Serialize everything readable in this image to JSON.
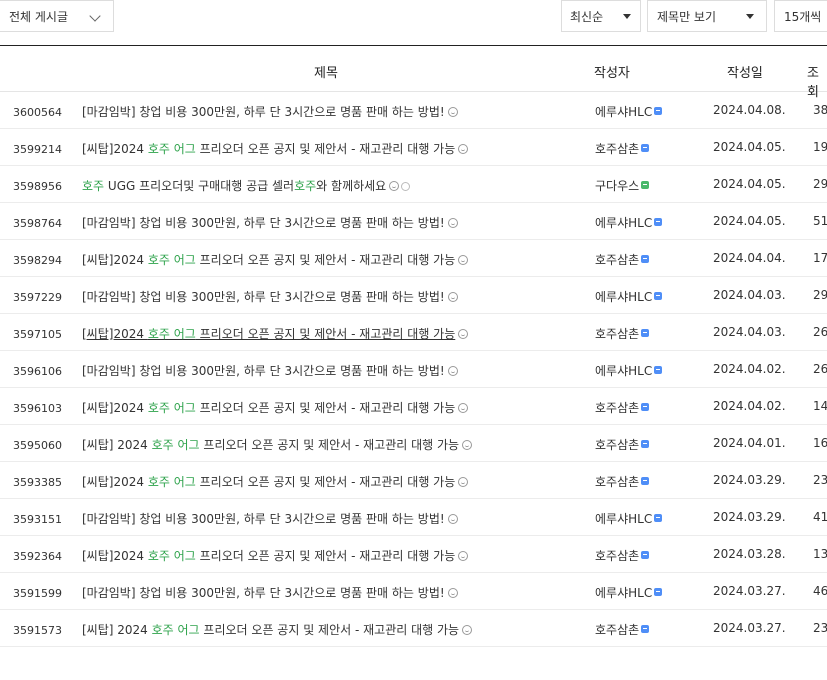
{
  "filters": {
    "all_posts": "전체 게시글",
    "sort": "최신순",
    "view_mode": "제목만 보기",
    "page_size": "15개씩"
  },
  "table": {
    "headers": {
      "title": "제목",
      "author": "작성자",
      "date": "작성일",
      "views": "조회"
    },
    "rows": [
      {
        "no": "3600564",
        "prefix": "[마감임박] 창업 비용 300만원, 하루 단 3시간으로 명품 판매 하는 방법!",
        "hl": "",
        "mid": "",
        "hl2": "",
        "suffix": "",
        "author": "에루샤HLC",
        "date": "2024.04.08.",
        "views": "38"
      },
      {
        "no": "3599214",
        "prefix": "[씨탑]2024 ",
        "hl": "호주 어그",
        "mid": " 프리오더 오픈 공지 및 제안서 - 재고관리 대행 가능",
        "hl2": "",
        "suffix": "",
        "author": "호주삼촌",
        "date": "2024.04.05.",
        "views": "19"
      },
      {
        "no": "3598956",
        "prefix": "",
        "hl": "호주",
        "mid": " UGG 프리오더및 구매대행 공급 셀러",
        "hl2": "호주",
        "suffix": "와 함께하세요",
        "author": "구다우스",
        "date": "2024.04.05.",
        "views": "29"
      },
      {
        "no": "3598764",
        "prefix": "[마감임박] 창업 비용 300만원, 하루 단 3시간으로 명품 판매 하는 방법!",
        "hl": "",
        "mid": "",
        "hl2": "",
        "suffix": "",
        "author": "에루샤HLC",
        "date": "2024.04.05.",
        "views": "51"
      },
      {
        "no": "3598294",
        "prefix": "[씨탑]2024 ",
        "hl": "호주 어그",
        "mid": " 프리오더 오픈 공지 및 제안서 - 재고관리 대행 가능",
        "hl2": "",
        "suffix": "",
        "author": "호주삼촌",
        "date": "2024.04.04.",
        "views": "17"
      },
      {
        "no": "3597229",
        "prefix": "[마감임박] 창업 비용 300만원, 하루 단 3시간으로 명품 판매 하는 방법!",
        "hl": "",
        "mid": "",
        "hl2": "",
        "suffix": "",
        "author": "에루샤HLC",
        "date": "2024.04.03.",
        "views": "29"
      },
      {
        "no": "3597105",
        "prefix": "[씨탑]2024 ",
        "hl": "호주 어그",
        "mid": " 프리오더 오픈 공지 및 제안서 - 재고관리 대행 가능",
        "hl2": "",
        "suffix": "",
        "author": "호주삼촌",
        "date": "2024.04.03.",
        "views": "26"
      },
      {
        "no": "3596106",
        "prefix": "[마감임박] 창업 비용 300만원, 하루 단 3시간으로 명품 판매 하는 방법!",
        "hl": "",
        "mid": "",
        "hl2": "",
        "suffix": "",
        "author": "에루샤HLC",
        "date": "2024.04.02.",
        "views": "26"
      },
      {
        "no": "3596103",
        "prefix": "[씨탑]2024 ",
        "hl": "호주 어그",
        "mid": " 프리오더 오픈 공지 및 제안서 - 재고관리 대행 가능",
        "hl2": "",
        "suffix": "",
        "author": "호주삼촌",
        "date": "2024.04.02.",
        "views": "14"
      },
      {
        "no": "3595060",
        "prefix": "[씨탑] 2024 ",
        "hl": "호주 어그",
        "mid": " 프리오더 오픈 공지 및 제안서 - 재고관리 대행 가능",
        "hl2": "",
        "suffix": "",
        "author": "호주삼촌",
        "date": "2024.04.01.",
        "views": "16"
      },
      {
        "no": "3593385",
        "prefix": "[씨탑]2024 ",
        "hl": "호주 어그",
        "mid": " 프리오더 오픈 공지 및 제안서 - 재고관리 대행 가능",
        "hl2": "",
        "suffix": "",
        "author": "호주삼촌",
        "date": "2024.03.29.",
        "views": "23"
      },
      {
        "no": "3593151",
        "prefix": "[마감임박] 창업 비용 300만원, 하루 단 3시간으로 명품 판매 하는 방법!",
        "hl": "",
        "mid": "",
        "hl2": "",
        "suffix": "",
        "author": "에루샤HLC",
        "date": "2024.03.29.",
        "views": "41"
      },
      {
        "no": "3592364",
        "prefix": "[씨탑]2024 ",
        "hl": "호주 어그",
        "mid": " 프리오더 오픈 공지 및 제안서 - 재고관리 대행 가능",
        "hl2": "",
        "suffix": "",
        "author": "호주삼촌",
        "date": "2024.03.28.",
        "views": "13"
      },
      {
        "no": "3591599",
        "prefix": "[마감임박] 창업 비용 300만원, 하루 단 3시간으로 명품 판매 하는 방법!",
        "hl": "",
        "mid": "",
        "hl2": "",
        "suffix": "",
        "author": "에루샤HLC",
        "date": "2024.03.27.",
        "views": "46"
      },
      {
        "no": "3591573",
        "prefix": "[씨탑] 2024 ",
        "hl": "호주 어그",
        "mid": " 프리오더 오픈 공지 및 제안서 - 재고관리 대행 가능",
        "hl2": "",
        "suffix": "",
        "author": "호주삼촌",
        "date": "2024.03.27.",
        "views": "23"
      }
    ]
  },
  "colors": {
    "highlight": "#2fa34c",
    "member_badge": "#4f8ef7",
    "new_member_badge": "#48b86a"
  }
}
